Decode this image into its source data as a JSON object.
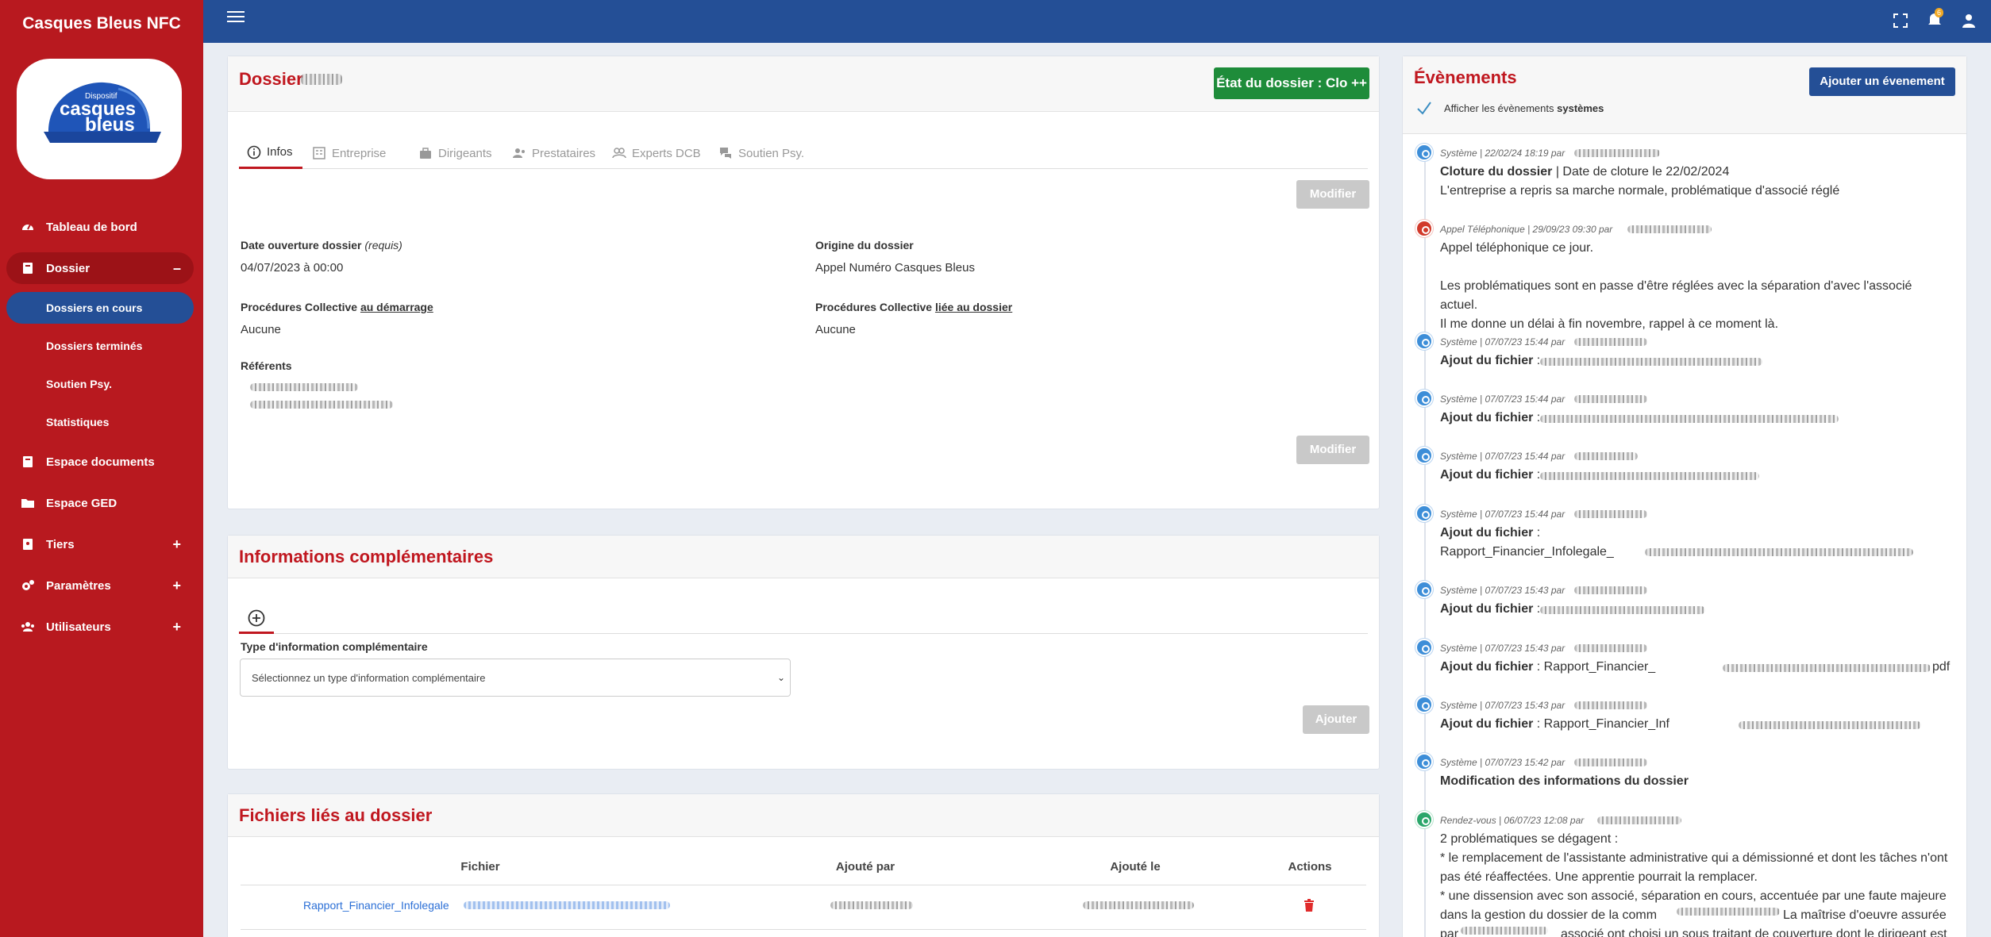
{
  "app": {
    "name": "Casques Bleus NFC",
    "logo_small": "Dispositif",
    "logo_line1": "casques",
    "logo_line2": "bleus"
  },
  "sidebar": {
    "items": [
      {
        "label": "Tableau de bord",
        "icon": "dashboard-icon"
      },
      {
        "label": "Dossier",
        "icon": "book-icon",
        "trail": "–"
      },
      {
        "label": "Dossiers en cours"
      },
      {
        "label": "Dossiers terminés"
      },
      {
        "label": "Soutien Psy."
      },
      {
        "label": "Statistiques"
      },
      {
        "label": "Espace documents",
        "icon": "book-icon"
      },
      {
        "label": "Espace GED",
        "icon": "folder-icon"
      },
      {
        "label": "Tiers",
        "icon": "address-book-icon",
        "trail": "+"
      },
      {
        "label": "Paramètres",
        "icon": "gears-icon",
        "trail": "+"
      },
      {
        "label": "Utilisateurs",
        "icon": "users-icon",
        "trail": "+"
      }
    ]
  },
  "topbar": {
    "notification_count": "6"
  },
  "dossier": {
    "title": "Dossier",
    "status_button": "État du dossier : Clo ++",
    "tabs": [
      "Infos",
      "Entreprise",
      "Dirigeants",
      "Prestataires",
      "Experts DCB",
      "Soutien Psy."
    ],
    "modify_label": "Modifier",
    "date_label": "Date ouverture dossier",
    "date_required": "(requis)",
    "date_value": "04/07/2023 à 00:00",
    "origin_label": "Origine du dossier",
    "origin_value": "Appel Numéro Casques Bleus",
    "proc_start_prefix": "Procédures Collective",
    "proc_start_link": "au démarrage",
    "proc_start_value": "Aucune",
    "proc_linked_prefix": "Procédures Collective",
    "proc_linked_link": "liée au dossier",
    "proc_linked_value": "Aucune",
    "referents_label": "Référents"
  },
  "info_comp": {
    "title": "Informations complémentaires",
    "type_label": "Type d'information complémentaire",
    "select_placeholder": "Sélectionnez un type d'information complémentaire",
    "add_label": "Ajouter"
  },
  "files": {
    "title": "Fichiers liés au dossier",
    "columns": [
      "Fichier",
      "Ajouté par",
      "Ajouté le",
      "Actions"
    ],
    "rows": [
      {
        "file": "Rapport_Financier_Infolegale"
      }
    ]
  },
  "events": {
    "title": "Évènements",
    "add_button": "Ajouter un évenement",
    "show_system_prefix": "Afficher les évènements",
    "show_system_bold": "systèmes",
    "items": [
      {
        "type": "system",
        "meta": "Système | 22/02/24 18:19 par",
        "title": "Cloture du dossier",
        "line1": "| Date de cloture le 22/02/2024",
        "line2": "L'entreprise a repris sa marche normale, problématique d'associé réglé"
      },
      {
        "type": "phone",
        "meta": "Appel Téléphonique | 29/09/23 09:30 par",
        "line1": "Appel téléphonique ce jour.",
        "line2": "Les problématiques sont en passe d'être réglées avec la séparation d'avec l'associé actuel.",
        "line3": "Il me donne un délai à fin novembre, rappel à ce moment là."
      },
      {
        "type": "system",
        "meta": "Système | 07/07/23 15:44 par",
        "title": "Ajout du fichier",
        "line1": ":"
      },
      {
        "type": "system",
        "meta": "Système | 07/07/23 15:44 par",
        "title": "Ajout du fichier",
        "line1": ":"
      },
      {
        "type": "system",
        "meta": "Système | 07/07/23 15:44 par",
        "title": "Ajout du fichier",
        "line1": ":"
      },
      {
        "type": "system",
        "meta": "Système | 07/07/23 15:44 par",
        "title": "Ajout du fichier",
        "line1": ":",
        "line2": "Rapport_Financier_Infolegale_"
      },
      {
        "type": "system",
        "meta": "Système | 07/07/23 15:43 par",
        "title": "Ajout du fichier",
        "line1": ":"
      },
      {
        "type": "system",
        "meta": "Système | 07/07/23 15:43 par",
        "title": "Ajout du fichier",
        "line1": ": Rapport_Financier_",
        "line2": "pdf"
      },
      {
        "type": "system",
        "meta": "Système | 07/07/23 15:43 par",
        "title": "Ajout du fichier",
        "line1": ": Rapport_Financier_Inf"
      },
      {
        "type": "system",
        "meta": "Système | 07/07/23 15:42 par",
        "title": "Modification des informations du dossier"
      },
      {
        "type": "meeting",
        "meta": "Rendez-vous | 06/07/23 12:08 par",
        "line1": "2 problématiques se dégagent :",
        "line2": "* le remplacement de l'assistante administrative qui a démissionné et dont les tâches n'ont",
        "line3": "pas été réaffectées. Une apprentie pourrait la remplacer.",
        "line4": "* une dissension avec son associé, séparation en cours, accentuée par une faute majeure",
        "line5": "dans la gestion du dossier de la comm",
        "line6": "La maîtrise d'oeuvre assurée",
        "line7": "par",
        "line8": "associé ont choisi un sous traitant de couverture dont le dirigeant est"
      }
    ]
  }
}
